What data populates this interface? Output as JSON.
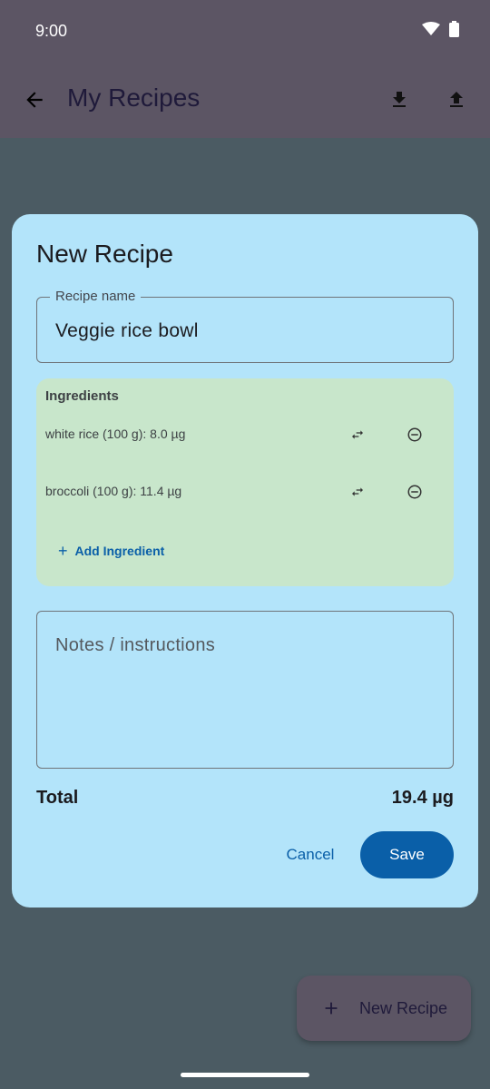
{
  "status_bar": {
    "time": "9:00"
  },
  "app_bar": {
    "title": "My Recipes",
    "back_icon": "arrow-back-icon",
    "actions": [
      "download-icon",
      "upload-icon"
    ]
  },
  "dialog": {
    "title": "New Recipe",
    "name_field": {
      "label": "Recipe name",
      "value": "Veggie rice bowl"
    },
    "ingredients": {
      "heading": "Ingredients",
      "items": [
        {
          "text": "white rice (100 g): 8.0 µg"
        },
        {
          "text": "broccoli (100 g): 11.4 µg"
        }
      ],
      "add_label": "Add Ingredient"
    },
    "notes_field": {
      "placeholder": "Notes / instructions",
      "value": ""
    },
    "total": {
      "label": "Total",
      "value": "19.4 µg"
    },
    "cancel_label": "Cancel",
    "save_label": "Save"
  },
  "fab": {
    "label": "New Recipe",
    "icon": "plus-icon"
  },
  "colors": {
    "app_bar": "#5c5564",
    "background": "#4b5b63",
    "dialog": "#b3e4fa",
    "ingredients_card": "#c8e6cb",
    "primary": "#0a5fa8"
  }
}
